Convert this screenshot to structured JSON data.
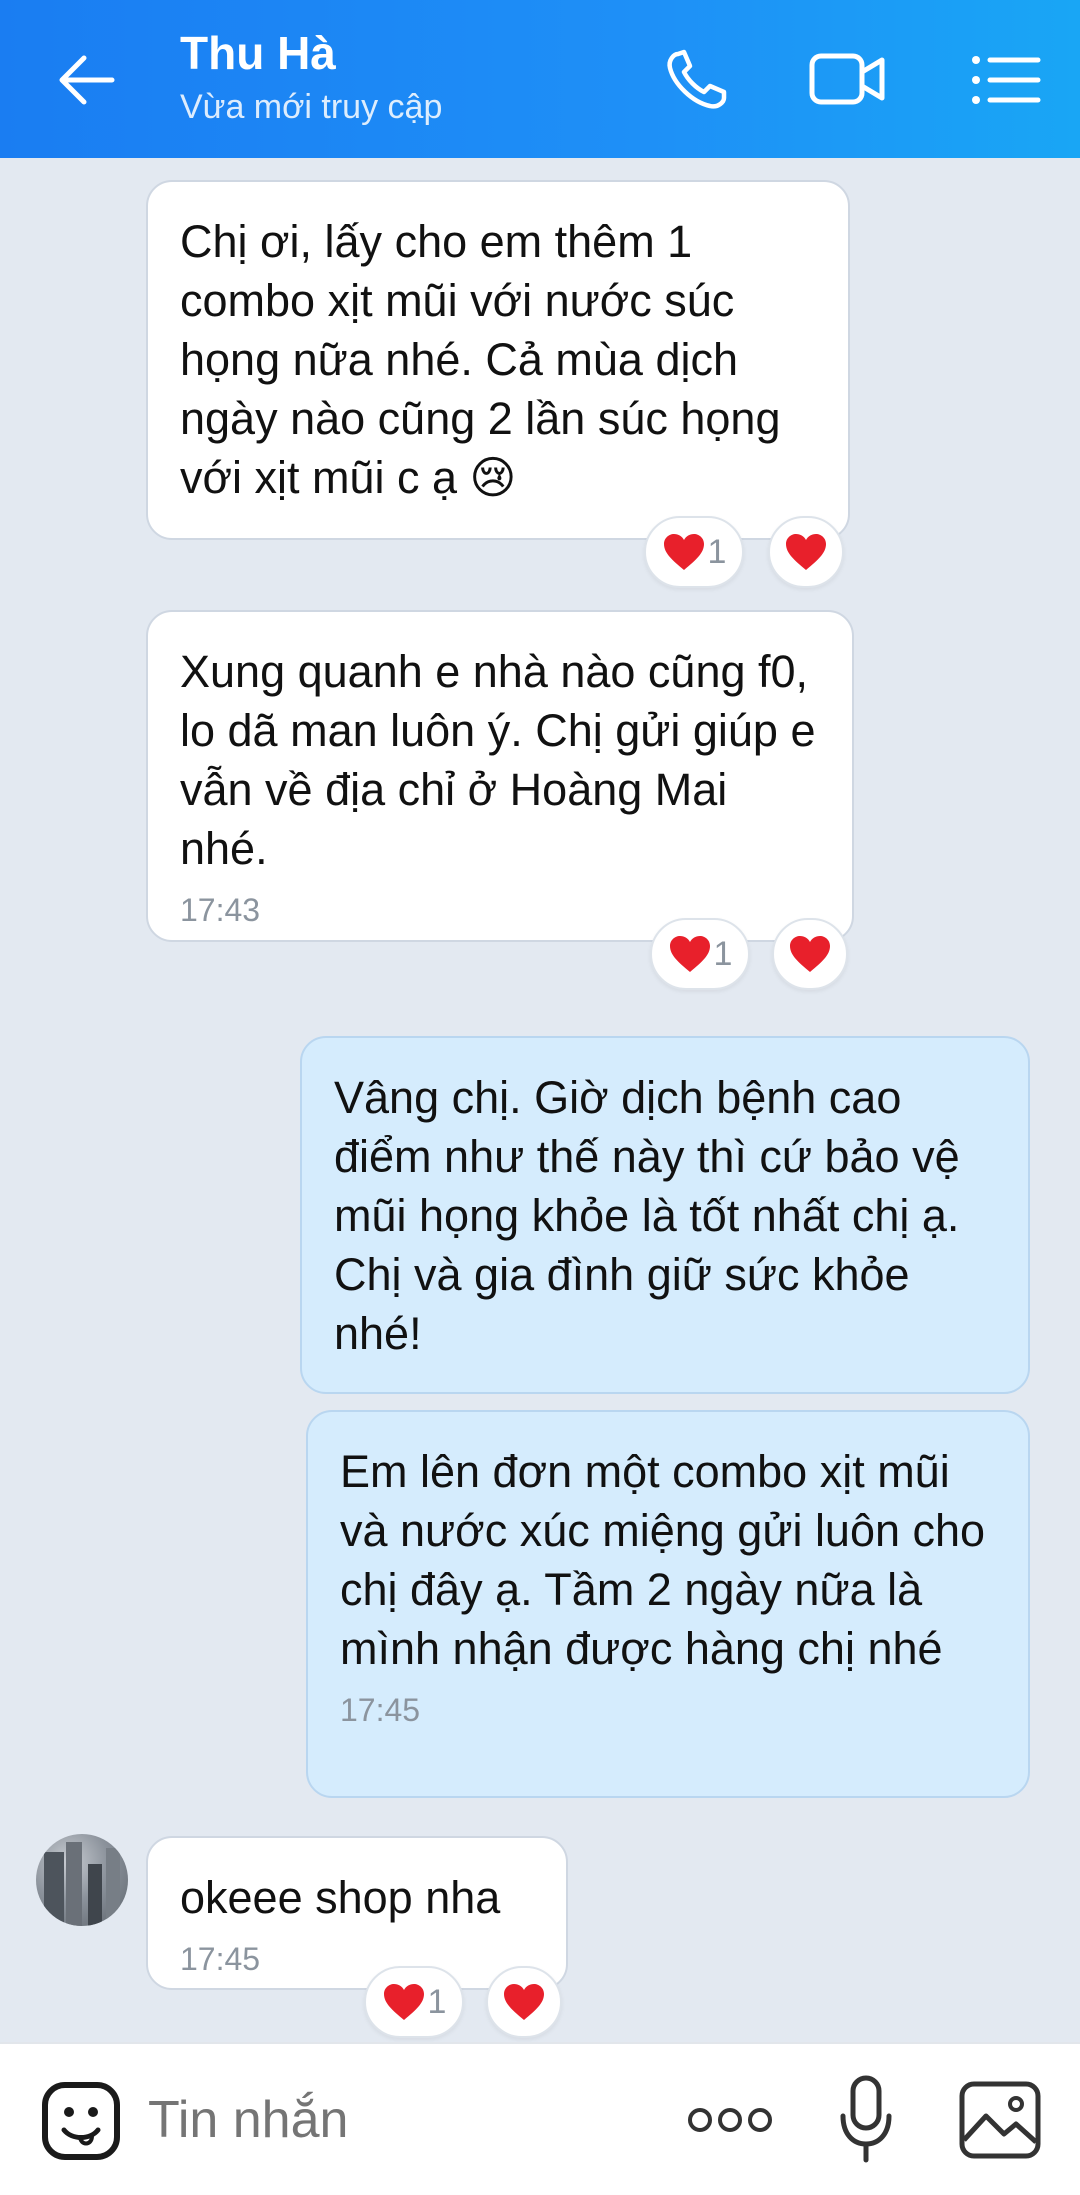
{
  "header": {
    "contact_name": "Thu Hà",
    "status": "Vừa mới truy cập",
    "color": "#1e8af5"
  },
  "messages": [
    {
      "direction": "in",
      "text": "Chị ơi, lấy cho em thêm 1 combo xịt mũi với nước súc họng nữa nhé. Cả mùa dịch ngày nào cũng 2 lần súc họng với xịt mũi c ạ 😢",
      "time": "",
      "reaction_count": "1"
    },
    {
      "direction": "in",
      "text": "Xung quanh e nhà nào cũng f0, lo dã man luôn ý. Chị gửi giúp e vẫn về địa chỉ ở Hoàng Mai nhé.",
      "time": "17:43",
      "reaction_count": "1"
    },
    {
      "direction": "out",
      "text": "Vâng chị. Giờ dịch bệnh cao điểm như thế này thì cứ bảo vệ mũi họng khỏe là tốt nhất chị ạ. Chị và gia đình giữ sức khỏe nhé!",
      "time": ""
    },
    {
      "direction": "out",
      "text": "Em lên đơn một combo xịt mũi và nước xúc miệng gửi luôn cho chị đây ạ. Tầm 2 ngày nữa là mình nhận được hàng chị nhé",
      "time": "17:45"
    },
    {
      "direction": "in",
      "text": "okeee shop nha",
      "time": "17:45",
      "reaction_count": "1"
    }
  ],
  "input": {
    "placeholder": "Tin nhắn"
  },
  "icons": {
    "back": "arrow-left-icon",
    "call": "phone-icon",
    "video": "video-camera-icon",
    "menu": "list-menu-icon",
    "emoji": "emoji-icon",
    "more": "more-dots-icon",
    "mic": "microphone-icon",
    "photo": "image-icon",
    "reaction": "heart-icon"
  },
  "colors": {
    "heart": "#e8202b",
    "incoming_bubble": "#ffffff",
    "outgoing_bubble": "#d5ecfd",
    "background": "#e3e9f1"
  }
}
